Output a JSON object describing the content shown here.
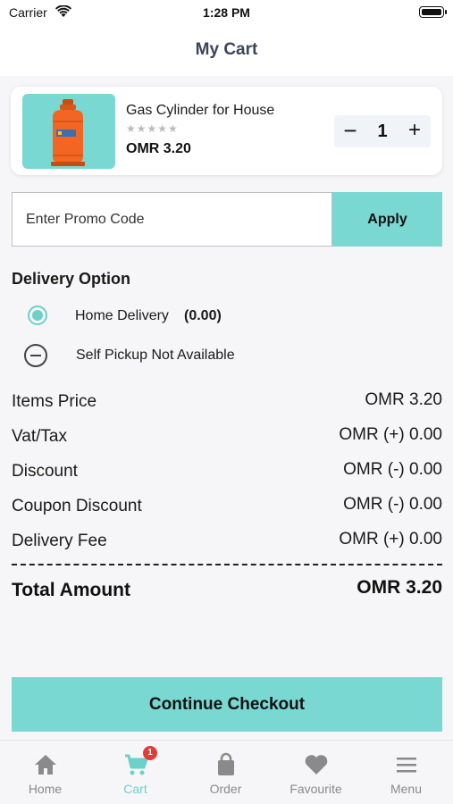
{
  "status_bar": {
    "carrier": "Carrier",
    "time": "1:28 PM"
  },
  "header": {
    "title": "My Cart"
  },
  "cart_item": {
    "name": "Gas Cylinder for House",
    "rating_stars": "★★★★★",
    "rating": 0,
    "price": "OMR 3.20",
    "quantity_minus": "−",
    "quantity": "1",
    "quantity_plus": "+"
  },
  "promo": {
    "placeholder": "Enter Promo Code",
    "apply_label": "Apply"
  },
  "delivery": {
    "title": "Delivery Option",
    "home_label": "Home Delivery",
    "home_fee": "(0.00)",
    "pickup_label": "Self Pickup Not Available"
  },
  "summary": {
    "rows": [
      {
        "label": "Items Price",
        "value": "OMR 3.20"
      },
      {
        "label": "Vat/Tax",
        "value": "OMR (+) 0.00"
      },
      {
        "label": "Discount",
        "value": "OMR (-) 0.00"
      },
      {
        "label": "Coupon Discount",
        "value": "OMR (-) 0.00"
      },
      {
        "label": "Delivery Fee",
        "value": "OMR (+) 0.00"
      }
    ],
    "total_label": "Total Amount",
    "total_value": "OMR 3.20"
  },
  "checkout": {
    "label": "Continue Checkout"
  },
  "tabbar": {
    "items": [
      {
        "label": "Home",
        "icon": "home-icon"
      },
      {
        "label": "Cart",
        "icon": "cart-icon",
        "badge": "1"
      },
      {
        "label": "Order",
        "icon": "bag-icon"
      },
      {
        "label": "Favourite",
        "icon": "heart-icon"
      },
      {
        "label": "Menu",
        "icon": "menu-icon"
      }
    ]
  },
  "colors": {
    "accent": "#7ad8d2",
    "badge": "#e53935",
    "product": "#f26522"
  }
}
